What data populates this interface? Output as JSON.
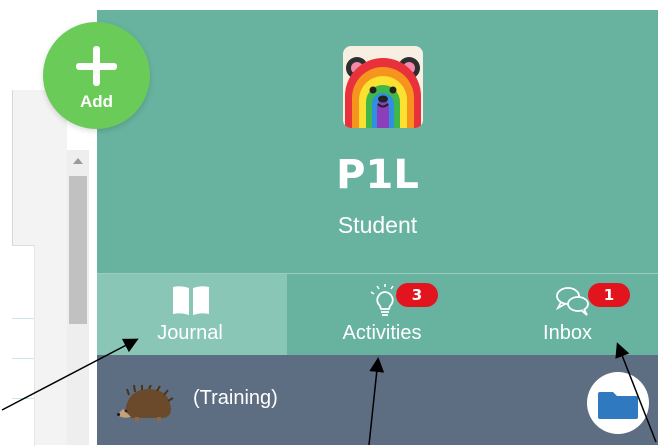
{
  "fab": {
    "label": "Add",
    "icon": "plus-icon"
  },
  "profile": {
    "name": "P1L",
    "role": "Student",
    "avatar": "rainbow-bear-avatar"
  },
  "tabs": [
    {
      "label": "Journal",
      "icon": "book-icon",
      "selected": true
    },
    {
      "label": "Activities",
      "icon": "lightbulb-icon",
      "badge": "3"
    },
    {
      "label": "Inbox",
      "icon": "chat-bubbles-icon",
      "badge": "1"
    }
  ],
  "footer": {
    "label": "(Training)",
    "avatar": "hedgehog-icon",
    "button_icon": "folder-icon"
  },
  "colors": {
    "panel": "#67b39f",
    "selected_tab": "#8ac6b6",
    "footer": "#5e6e82",
    "badge": "#e2141d",
    "fab": "#6acb59",
    "folder": "#2f79c1"
  }
}
